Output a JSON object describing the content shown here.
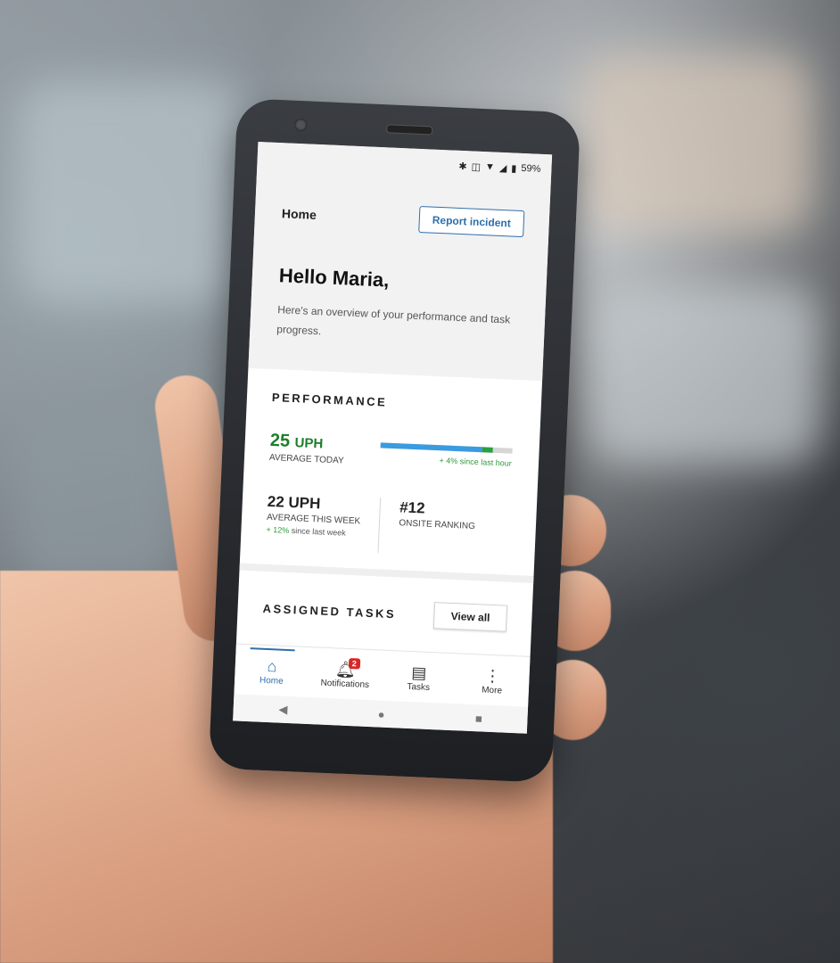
{
  "status_bar": {
    "battery": "59%",
    "icons": [
      "bluetooth-icon",
      "vibrate-icon",
      "wifi-icon",
      "signal-icon",
      "battery-icon"
    ]
  },
  "header": {
    "title": "Home",
    "report_label": "Report incident"
  },
  "greeting": {
    "title": "Hello Maria,",
    "subtitle": "Here's an overview of your performance and task progress."
  },
  "performance": {
    "title": "PERFORMANCE",
    "today": {
      "value": "25",
      "unit": "UPH",
      "label": "AVERAGE TODAY",
      "delta": "+ 4% since last hour",
      "progress_fraction": 0.85
    },
    "week": {
      "value": "22 UPH",
      "label": "AVERAGE THIS WEEK",
      "delta_value": "+ 12%",
      "delta_text": "since last week"
    },
    "ranking": {
      "value": "#12",
      "label": "ONSITE RANKING"
    }
  },
  "tasks": {
    "title": "ASSIGNED TASKS",
    "view_all_label": "View all"
  },
  "bottom_nav": {
    "items": [
      {
        "label": "Home",
        "icon": "home-icon"
      },
      {
        "label": "Notifications",
        "icon": "bell-icon",
        "badge": "2"
      },
      {
        "label": "Tasks",
        "icon": "document-icon"
      },
      {
        "label": "More",
        "icon": "more-vertical-icon"
      }
    ]
  },
  "colors": {
    "accent": "#2f6fad",
    "positive": "#2e9a3e",
    "badge": "#d62828",
    "progress": "#3a9be0"
  }
}
